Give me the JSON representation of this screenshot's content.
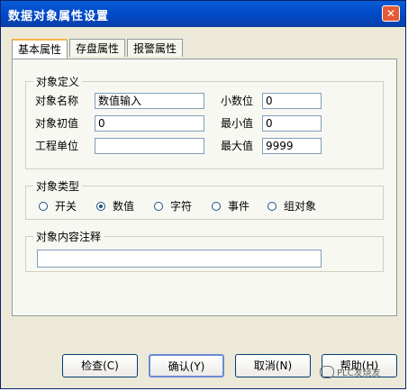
{
  "window": {
    "title": "数据对象属性设置",
    "close_glyph": "✕"
  },
  "tabs": [
    {
      "label": "基本属性",
      "active": true
    },
    {
      "label": "存盘属性",
      "active": false
    },
    {
      "label": "报警属性",
      "active": false
    }
  ],
  "definition": {
    "legend": "对象定义",
    "name_label": "对象名称",
    "name_value": "数值输入",
    "init_label": "对象初值",
    "init_value": "0",
    "unit_label": "工程单位",
    "unit_value": "",
    "decimal_label": "小数位",
    "decimal_value": "0",
    "min_label": "最小值",
    "min_value": "0",
    "max_label": "最大值",
    "max_value": "9999"
  },
  "type": {
    "legend": "对象类型",
    "options": [
      {
        "label": "开关",
        "selected": false
      },
      {
        "label": "数值",
        "selected": true
      },
      {
        "label": "字符",
        "selected": false
      },
      {
        "label": "事件",
        "selected": false
      },
      {
        "label": "组对象",
        "selected": false
      }
    ]
  },
  "comment": {
    "legend": "对象内容注释",
    "value": ""
  },
  "buttons": {
    "check": "检查(C)",
    "confirm": "确认(Y)",
    "cancel": "取消(N)",
    "help": "帮助(H)"
  },
  "watermark": {
    "text": "PLC发烧友"
  }
}
